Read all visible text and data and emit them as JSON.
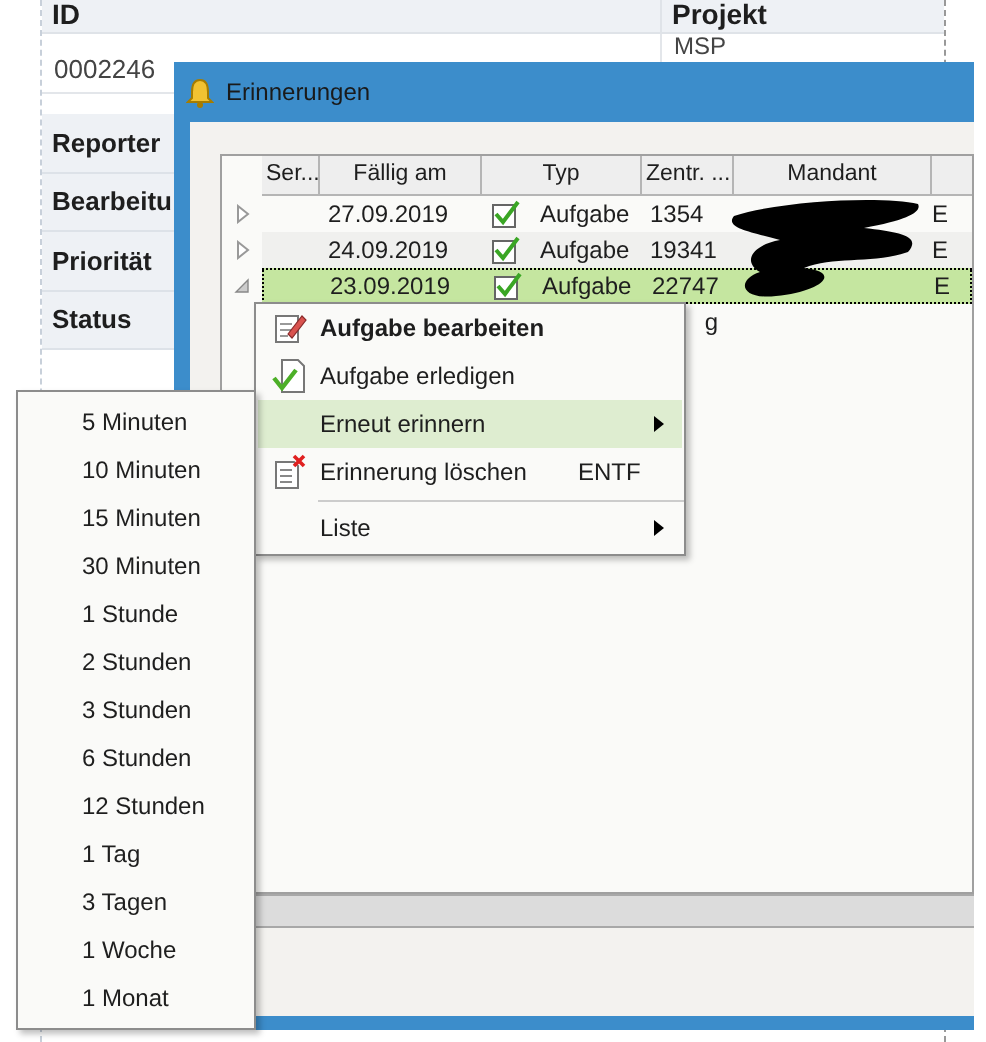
{
  "background_form": {
    "columns": [
      "ID",
      "Projekt"
    ],
    "values": [
      "0002246",
      "MSP"
    ],
    "fields": [
      "Reporter",
      "Bearbeitu",
      "Priorität",
      "Status"
    ]
  },
  "window": {
    "title": "Erinnerungen"
  },
  "grid": {
    "columns": [
      "Ser...",
      "Fällig am",
      "Typ",
      "Zentr. ...",
      "Mandant"
    ],
    "rows": [
      {
        "expanded": false,
        "selected": false,
        "due": "27.09.2019",
        "done": true,
        "type": "Aufgabe",
        "zentr": "1354",
        "column_6": "E"
      },
      {
        "expanded": false,
        "selected": false,
        "due": "24.09.2019",
        "done": true,
        "type": "Aufgabe",
        "zentr": "19341",
        "column_6": "E"
      },
      {
        "expanded": true,
        "selected": true,
        "due": "23.09.2019",
        "done": true,
        "type": "Aufgabe",
        "zentr": "22747",
        "column_6": "E"
      },
      {
        "zentr": "g"
      }
    ]
  },
  "context_menu": {
    "items": [
      {
        "kind": "item",
        "label": "Aufgabe bearbeiten",
        "default": true,
        "selected": false,
        "submenu": false
      },
      {
        "kind": "item",
        "label": "Aufgabe erledigen",
        "default": false,
        "selected": false,
        "submenu": false
      },
      {
        "kind": "item",
        "label": "Erneut erinnern",
        "default": false,
        "selected": true,
        "submenu": true
      },
      {
        "kind": "item",
        "label": "Erinnerung löschen",
        "shortcut": "ENTF",
        "default": false,
        "selected": false,
        "submenu": false
      },
      {
        "kind": "separator"
      },
      {
        "kind": "item",
        "label": "Liste",
        "default": false,
        "selected": false,
        "submenu": true
      }
    ]
  },
  "submenu": {
    "items": [
      "5 Minuten",
      "10 Minuten",
      "15 Minuten",
      "30 Minuten",
      "1 Stunde",
      "2 Stunden",
      "3 Stunden",
      "6 Stunden",
      "12 Stunden",
      "1 Tag",
      "3 Tagen",
      "1 Woche",
      "1 Monat"
    ]
  }
}
